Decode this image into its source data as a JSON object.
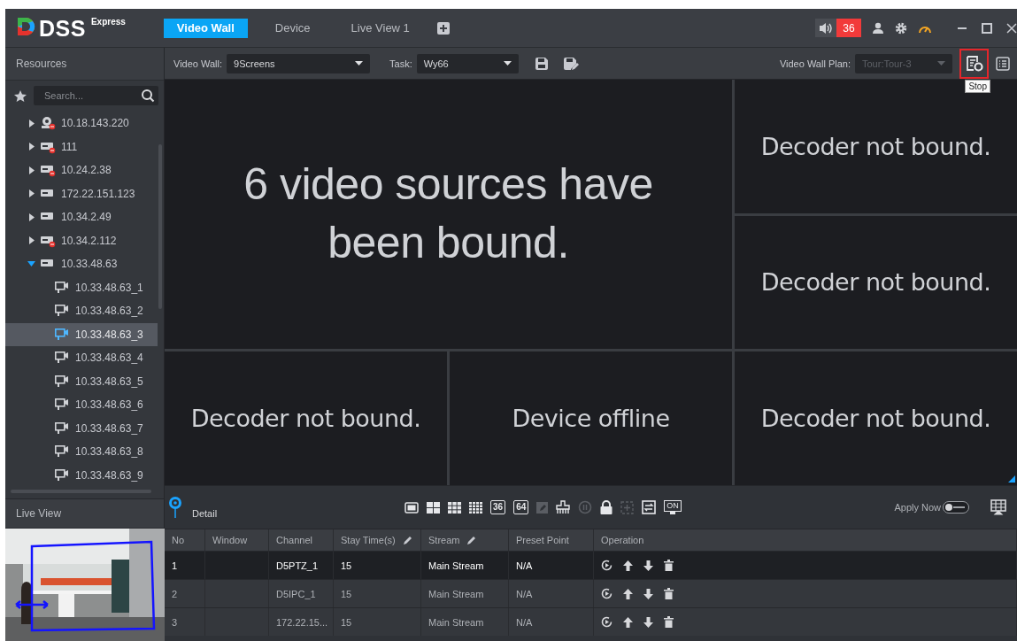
{
  "window": {
    "logo": {
      "name": "DSS",
      "edition": "Express"
    },
    "tabs": [
      {
        "label": "Video Wall",
        "selected": true
      },
      {
        "label": "Device",
        "selected": false
      },
      {
        "label": "Live View 1",
        "selected": false
      }
    ],
    "alarm": {
      "count": "36"
    }
  },
  "toolbar": {
    "selectors": [
      {
        "label": "Video Wall:",
        "value": "9Screens",
        "disabled": false
      },
      {
        "label": "Task:",
        "value": "Wy66",
        "disabled": false
      }
    ],
    "plan": {
      "label": "Video Wall Plan:",
      "value": "Tour:Tour-3",
      "disabled": true
    },
    "stop_button": {
      "tooltip": "Stop",
      "highlighted": true
    }
  },
  "sidebar": {
    "title": "Resources",
    "search": {
      "placeholder": "Search..."
    },
    "tree": [
      {
        "label": "10.18.143.220",
        "kind": "camera",
        "online": false,
        "expanded": false
      },
      {
        "label": "111",
        "kind": "device",
        "online": false,
        "expanded": false
      },
      {
        "label": "10.24.2.38",
        "kind": "device",
        "online": false,
        "expanded": false
      },
      {
        "label": "172.22.151.123",
        "kind": "device",
        "online": true,
        "expanded": false
      },
      {
        "label": "10.34.2.49",
        "kind": "device",
        "online": true,
        "expanded": false
      },
      {
        "label": "10.34.2.112",
        "kind": "device",
        "online": false,
        "expanded": false
      },
      {
        "label": "10.33.48.63",
        "kind": "device",
        "online": true,
        "expanded": true,
        "children": [
          {
            "label": "10.33.48.63_1",
            "kind": "channel",
            "selected": false
          },
          {
            "label": "10.33.48.63_2",
            "kind": "channel",
            "selected": false
          },
          {
            "label": "10.33.48.63_3",
            "kind": "channel",
            "selected": true
          },
          {
            "label": "10.33.48.63_4",
            "kind": "channel",
            "selected": false
          },
          {
            "label": "10.33.48.63_5",
            "kind": "channel",
            "selected": false
          },
          {
            "label": "10.33.48.63_6",
            "kind": "channel",
            "selected": false
          },
          {
            "label": "10.33.48.63_7",
            "kind": "channel",
            "selected": false
          },
          {
            "label": "10.33.48.63_8",
            "kind": "channel",
            "selected": false
          },
          {
            "label": "10.33.48.63_9",
            "kind": "channel",
            "selected": false
          }
        ]
      }
    ],
    "live_view": {
      "title": "Live View"
    }
  },
  "wall": {
    "cells": [
      {
        "kind": "large",
        "text": "6 video sources have been bound."
      },
      {
        "kind": "normal",
        "text": "Decoder not bound."
      },
      {
        "kind": "normal",
        "text": "Decoder not bound."
      },
      {
        "kind": "normal",
        "text": "Decoder not bound."
      },
      {
        "kind": "normal",
        "text": "Device offline"
      },
      {
        "kind": "normal",
        "text": "Decoder not bound."
      }
    ]
  },
  "detail": {
    "title": "Detail",
    "tools": [
      {
        "kind": "single",
        "disabled": false
      },
      {
        "kind": "quad",
        "disabled": false
      },
      {
        "kind": "nine",
        "disabled": false
      },
      {
        "kind": "sixteen",
        "disabled": false
      },
      {
        "kind": "count",
        "label": "36",
        "disabled": false
      },
      {
        "kind": "count",
        "label": "64",
        "disabled": false
      },
      {
        "kind": "edit",
        "disabled": true
      },
      {
        "kind": "clear",
        "disabled": false
      },
      {
        "kind": "pause",
        "disabled": true
      },
      {
        "kind": "lock",
        "disabled": false
      },
      {
        "kind": "add",
        "disabled": true
      },
      {
        "kind": "swap",
        "disabled": false
      },
      {
        "kind": "screen",
        "label": "ON",
        "disabled": false
      }
    ],
    "apply_now": {
      "label": "Apply Now",
      "on": false
    },
    "table": {
      "columns": [
        {
          "label": "No",
          "editable": false
        },
        {
          "label": "Window",
          "editable": false
        },
        {
          "label": "Channel",
          "editable": false
        },
        {
          "label": "Stay Time(s)",
          "editable": true
        },
        {
          "label": "Stream",
          "editable": true
        },
        {
          "label": "Preset Point",
          "editable": false
        },
        {
          "label": "Operation",
          "editable": false
        }
      ],
      "rows": [
        {
          "no": "1",
          "window": "",
          "channel": "D5PTZ_1",
          "stay": "15",
          "stream": "Main Stream",
          "preset": "N/A",
          "selected": true
        },
        {
          "no": "2",
          "window": "",
          "channel": "D5IPC_1",
          "stay": "15",
          "stream": "Main Stream",
          "preset": "N/A",
          "selected": false
        },
        {
          "no": "3",
          "window": "",
          "channel": "172.22.15...",
          "stay": "15",
          "stream": "Main Stream",
          "preset": "N/A",
          "selected": false
        }
      ]
    }
  }
}
